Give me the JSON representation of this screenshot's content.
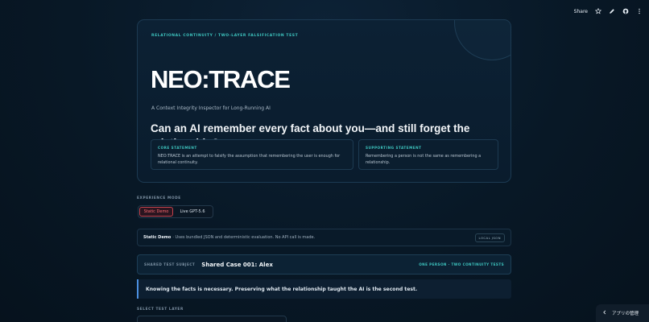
{
  "topbar": {
    "share_label": "Share",
    "icons": [
      "star-icon",
      "pencil-icon",
      "github-icon",
      "more-vertical-icon"
    ]
  },
  "hero": {
    "eyebrow": "RELATIONAL CONTINUITY / TWO-LAYER FALSIFICATION TEST",
    "title": "NEO:TRACE",
    "subtitle": "A Context Integrity Inspector for Long-Running AI",
    "headline": "Can an AI remember every fact about you—and still forget the relationship?",
    "core_statement": {
      "label": "CORE STATEMENT",
      "text": "NEO:TRACE is an attempt to falsify the assumption that remembering the user is enough for relational continuity."
    },
    "supporting_statement": {
      "label": "SUPPORTING STATEMENT",
      "text": "Remembering a person is not the same as remembering a relationship."
    }
  },
  "mode": {
    "label": "EXPERIENCE MODE",
    "options": [
      "Static Demo",
      "Live GPT-5.6"
    ],
    "selected": "Static Demo"
  },
  "info": {
    "mode_name": "Static Demo",
    "description": "· Uses bundled JSON and deterministic evaluation. No API call is made.",
    "badge": "LOCAL JSON"
  },
  "subject": {
    "label": "SHARED TEST SUBJECT",
    "name": "Shared Case 001: Alex",
    "tag": "ONE PERSON · TWO CONTINUITY TESTS"
  },
  "quote": "Knowing the facts is necessary. Preserving what the relationship taught the AI is the second test.",
  "layer": {
    "label": "SELECT TEST LAYER"
  },
  "manage_app": "アプリの管理",
  "colors": {
    "accent_teal": "#3ec6c0",
    "active_red": "#ff6b72",
    "quote_border": "#4b8fe0",
    "background": "#081826"
  }
}
